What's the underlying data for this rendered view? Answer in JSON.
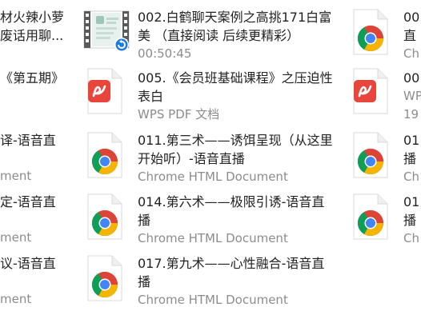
{
  "col_left": {
    "r1_line1": "材火辣小萝",
    "r1_line2": "废话用聊...",
    "r2_line1": "《第五期》",
    "r3_line1": "译-语音直",
    "r3_line2": "ment",
    "r4_line1": "定-语音直",
    "r4_line2": "ment",
    "r5_line1": "议-语音直",
    "r5_line2": "ment"
  },
  "col_mid": [
    {
      "line1": "002.白鹤聊天案例之高挑171白富",
      "line2": "美 （直接阅读 后续更精彩）",
      "sub": "00:50:45",
      "icon": "video-thumbnail-icon"
    },
    {
      "line1": "005.《会员班基础课程》之压迫性",
      "line2": "表白",
      "sub": "WPS PDF 文档",
      "icon": "wps-pdf-icon"
    },
    {
      "line1": "011.第三术——诱饵呈现（从这里",
      "line2": "开始听）-语音直播",
      "sub": "Chrome HTML Document",
      "icon": "chrome-icon"
    },
    {
      "line1": "014.第六术——极限引诱-语音直",
      "line2": "播",
      "sub": "Chrome HTML Document",
      "icon": "chrome-icon"
    },
    {
      "line1": "017.第九术——心性融合-语音直",
      "line2": "播",
      "sub": "Chrome HTML Document",
      "icon": "chrome-icon"
    }
  ],
  "col_right": [
    {
      "line1": "00",
      "line2": "直",
      "sub": "Ch"
    },
    {
      "line1": "00",
      "line2": "WP",
      "sub": "19"
    },
    {
      "line1": "01",
      "line2": "播",
      "sub": "Ch"
    },
    {
      "line1": "01",
      "line2": "播",
      "sub": "Ch"
    }
  ],
  "colors": {
    "chrome_red": "#DB4437",
    "chrome_green": "#0F9D58",
    "chrome_yellow": "#F4B400",
    "chrome_blue": "#4285F4",
    "wps_red": "#E8463C",
    "text": "#222222",
    "subtext": "#8c8c8c"
  }
}
